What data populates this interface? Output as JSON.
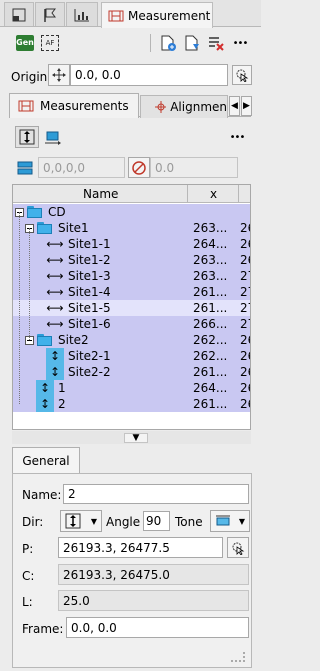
{
  "window_tabs": {
    "active_label": "Measurement",
    "icons": [
      "layers-icon",
      "flag-icon",
      "chart-icon",
      "ruler-icon"
    ]
  },
  "toolbar": {
    "gen_label": "Gen",
    "af_label": "AF",
    "more": "•••"
  },
  "origin": {
    "label": "Origin:",
    "value": "0.0, 0.0"
  },
  "inner_tabs": {
    "measurements_label": "Measurements",
    "alignment_label": "Alignmen"
  },
  "inner_toolbar": {
    "more": "•••"
  },
  "filters": {
    "left_value": "0,0,0,0",
    "right_value": "0.0"
  },
  "tree": {
    "columns": {
      "name": "Name",
      "x": "x"
    },
    "rows": [
      {
        "name": "CD",
        "x": "",
        "y": ""
      },
      {
        "name": "Site1",
        "x": "263...",
        "y": "26"
      },
      {
        "name": "Site1-1",
        "x": "264...",
        "y": "26"
      },
      {
        "name": "Site1-2",
        "x": "263...",
        "y": "26"
      },
      {
        "name": "Site1-3",
        "x": "263...",
        "y": "27"
      },
      {
        "name": "Site1-4",
        "x": "261...",
        "y": "27"
      },
      {
        "name": "Site1-5",
        "x": "261...",
        "y": "27"
      },
      {
        "name": "Site1-6",
        "x": "266...",
        "y": "27"
      },
      {
        "name": "Site2",
        "x": "262...",
        "y": "26"
      },
      {
        "name": "Site2-1",
        "x": "262...",
        "y": "26"
      },
      {
        "name": "Site2-2",
        "x": "261...",
        "y": "26"
      },
      {
        "name": "1",
        "x": "264...",
        "y": "26"
      },
      {
        "name": "2",
        "x": "261...",
        "y": "26"
      }
    ]
  },
  "details": {
    "tab_label": "General",
    "name_label": "Name:",
    "name_value": "2",
    "dir_label": "Dir:",
    "angle_label": "Angle",
    "angle_value": "90",
    "tone_label": "Tone",
    "p_label": "P:",
    "p_value": "26193.3, 26477.5",
    "c_label": "C:",
    "c_value": "26193.3, 26475.0",
    "l_label": "L:",
    "l_value": "25.0",
    "frame_label": "Frame:",
    "frame_value": "0.0, 0.0"
  }
}
